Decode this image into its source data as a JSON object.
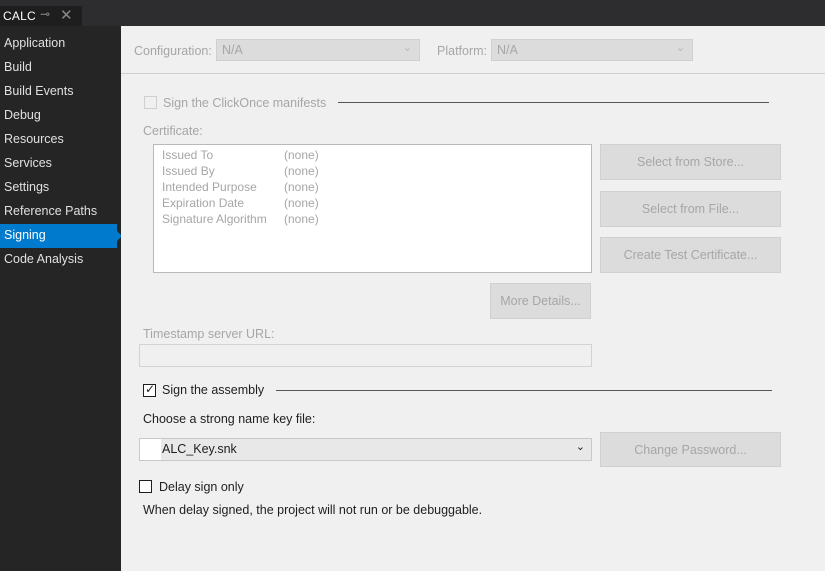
{
  "tab": {
    "title": "CALC",
    "pin_glyph": "⊸",
    "close_glyph": "✕"
  },
  "sidebar": {
    "items": [
      {
        "label": "Application"
      },
      {
        "label": "Build"
      },
      {
        "label": "Build Events"
      },
      {
        "label": "Debug"
      },
      {
        "label": "Resources"
      },
      {
        "label": "Services"
      },
      {
        "label": "Settings"
      },
      {
        "label": "Reference Paths"
      },
      {
        "label": "Signing"
      },
      {
        "label": "Code Analysis"
      }
    ],
    "active": "Signing"
  },
  "config": {
    "configuration_label": "Configuration:",
    "configuration_value": "N/A",
    "platform_label": "Platform:",
    "platform_value": "N/A",
    "chev": "⌄"
  },
  "clickonce": {
    "label": "Sign the ClickOnce manifests",
    "checked": false
  },
  "certificate": {
    "label": "Certificate:",
    "rows": [
      {
        "key": "Issued To",
        "value": "(none)"
      },
      {
        "key": "Issued By",
        "value": "(none)"
      },
      {
        "key": "Intended Purpose",
        "value": "(none)"
      },
      {
        "key": "Expiration Date",
        "value": "(none)"
      },
      {
        "key": "Signature Algorithm",
        "value": "(none)"
      }
    ],
    "select_store": "Select from Store...",
    "select_file": "Select from File...",
    "create_test": "Create Test Certificate...",
    "more_details": "More Details..."
  },
  "timestamp": {
    "label": "Timestamp server URL:",
    "value": ""
  },
  "assembly": {
    "label": "Sign the assembly",
    "checked": true,
    "check_glyph": "✓",
    "key_label": "Choose a strong name key file:",
    "key_value": "ALC_Key.snk",
    "chev": "⌄",
    "change_password": "Change Password..."
  },
  "delay": {
    "label": "Delay sign only",
    "checked": false,
    "note": "When delay signed, the project will not run or be debuggable."
  },
  "colors": {
    "accent": "#007acc",
    "sidebar_bg": "#252526",
    "tab_bg": "#2d2d30"
  }
}
